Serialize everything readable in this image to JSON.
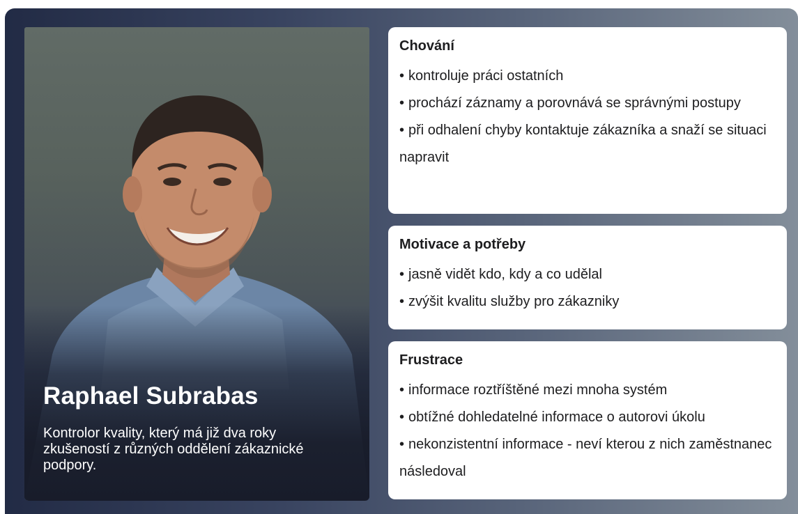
{
  "persona": {
    "name": "Raphael Subrabas",
    "description": "Kontrolor kvality, který má již dva roky zkušeností z různých oddělení zákaznické podpory."
  },
  "sections": {
    "behavior": {
      "title": "Chování",
      "items": [
        "kontroluje práci ostatních",
        "prochází záznamy a porovnává se správnými postupy",
        "při odhalení chyby kontaktuje zákazníka a snaží se situaci napravit"
      ]
    },
    "motivation": {
      "title": "Motivace a potřeby",
      "items": [
        "jasně vidět kdo, kdy a co udělal",
        "zvýšit kvalitu služby pro zákazniky"
      ]
    },
    "frustration": {
      "title": "Frustrace",
      "items": [
        "informace roztříštěné mezi mnoha systém",
        "obtížné dohledatelné informace o autorovi úkolu",
        "nekonzistentní informace - neví kterou z nich zaměstnanec následoval"
      ]
    }
  },
  "bullet": "•",
  "colors": {
    "frame_gradient_start": "#222b45",
    "frame_gradient_end": "#838e9a",
    "card_background": "#ffffff",
    "text_dark": "#1d1d1f",
    "text_light": "#ffffff"
  }
}
